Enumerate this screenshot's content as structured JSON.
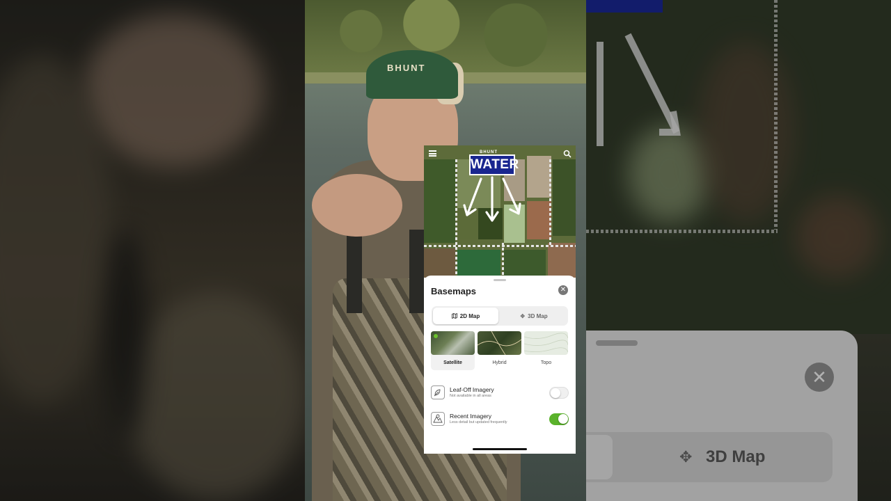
{
  "map": {
    "water_label": "WATER",
    "logo_text": "BHUNT"
  },
  "cap": {
    "text": "BHUNT"
  },
  "basemaps": {
    "title": "Basemaps",
    "close_glyph": "✕",
    "tabs": [
      {
        "label": "2D Map",
        "icon": "map-icon",
        "active": true
      },
      {
        "label": "3D Map",
        "icon": "3d-icon",
        "active": false
      }
    ],
    "styles": [
      {
        "label": "Satellite",
        "selected": true
      },
      {
        "label": "Hybrid",
        "selected": false
      },
      {
        "label": "Topo",
        "selected": false
      }
    ],
    "options": [
      {
        "title": "Leaf-Off Imagery",
        "subtitle": "Not available in all areas",
        "enabled": false,
        "icon": "leaf-icon"
      },
      {
        "title": "Recent Imagery",
        "subtitle": "Less detail but updated frequently",
        "enabled": true,
        "icon": "recent-imagery-icon"
      }
    ]
  },
  "background_zoom": {
    "tab_label": "3D Map",
    "close_glyph": "✕"
  },
  "colors": {
    "accent_green": "#5ab22b",
    "water_label_bg": "#19268f"
  }
}
